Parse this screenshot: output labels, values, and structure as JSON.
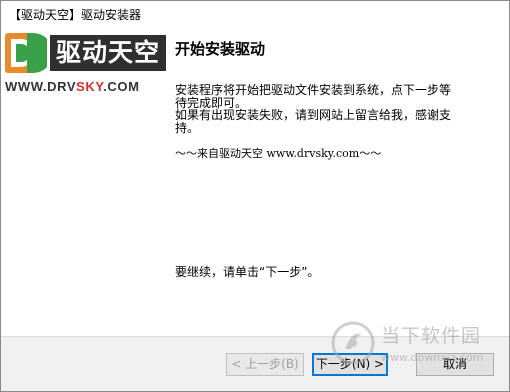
{
  "window": {
    "title": "【驱动天空】驱动安装器"
  },
  "logo": {
    "cn_text": "驱动天空",
    "url_prefix": "WWW.DRV",
    "url_accent": "SKY",
    "url_suffix": ".COM",
    "icon": "drvsky-d-logo-icon",
    "colors": {
      "orange": "#e98b2a",
      "green": "#3aa04a",
      "dark": "#2f2f2f",
      "red": "#c8342d"
    }
  },
  "main": {
    "heading": "开始安装驱动",
    "para1_line1": "安装程序将开始把驱动文件安装到系统，点下一步等",
    "para1_line2": "待完成即可。",
    "para2_line1": "如果有出现安装失败，请到网站上留言给我，感谢支",
    "para2_line2": "持。",
    "source_line": "～～来自驱动天空 www.drvsky.com～～",
    "continue_text": "要继续，请单击“下一步”。"
  },
  "buttons": {
    "back_label": "< 上一步(B)",
    "next_label": "下一步(N) >",
    "cancel_label": "取消"
  },
  "watermark": {
    "title": "当下软件园",
    "url": "www.downxia.com",
    "icon": "downxia-logo-icon"
  }
}
